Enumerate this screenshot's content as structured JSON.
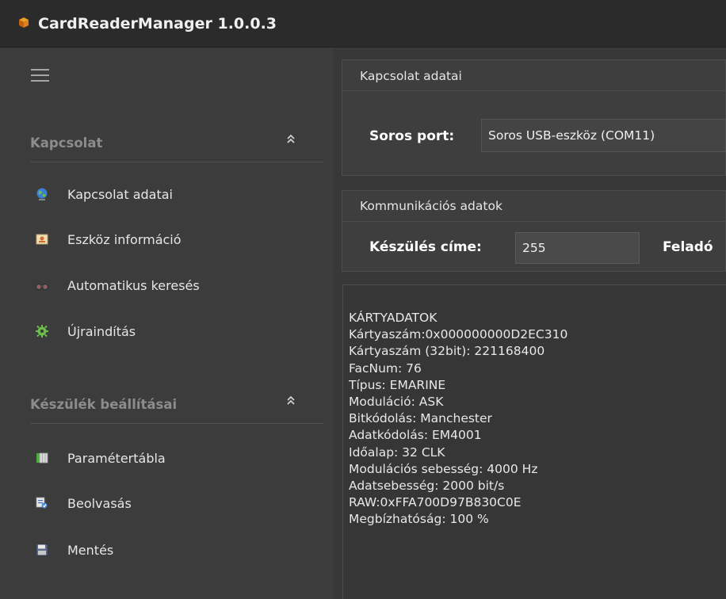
{
  "window": {
    "title": "CardReaderManager 1.0.0.3"
  },
  "sidebar": {
    "menu_icon": "hamburger-icon",
    "sections": [
      {
        "label": "Kapcsolat",
        "items": [
          {
            "label": "Kapcsolat adatai",
            "icon": "globe-icon"
          },
          {
            "label": "Eszköz információ",
            "icon": "device-info-icon"
          },
          {
            "label": "Automatikus keresés",
            "icon": "binoculars-icon"
          },
          {
            "label": "Újraindítás",
            "icon": "restart-gear-icon"
          }
        ]
      },
      {
        "label": "Készülék beállításai",
        "items": [
          {
            "label": "Paramétertábla",
            "icon": "table-icon"
          },
          {
            "label": "Beolvasás",
            "icon": "read-icon"
          },
          {
            "label": "Mentés",
            "icon": "save-icon"
          }
        ]
      }
    ]
  },
  "connection_panel": {
    "title": "Kapcsolat adatai",
    "serial_port_label": "Soros port:",
    "serial_port_value": "Soros USB-eszköz (COM11)"
  },
  "communication_panel": {
    "title": "Kommunikációs adatok",
    "device_address_label": "Készülés címe:",
    "device_address_value": "255",
    "sender_label": "Feladó"
  },
  "output": {
    "lines": [
      "KÁRTYADATOK",
      "Kártyaszám:0x000000000D2EC310",
      "Kártyaszám (32bit): 221168400",
      "FacNum: 76",
      "Típus: EMARINE",
      "Moduláció: ASK",
      "Bitkódolás: Manchester",
      "Adatkódolás: EM4001",
      "Időalap: 32 CLK",
      "Modulációs sebesség: 4000 Hz",
      "Adatsebesség: 2000 bit/s",
      "RAW:0xFFA700D97B830C0E",
      "Megbízhatóság: 100 %"
    ]
  },
  "colors": {
    "background": "#3a3a3a",
    "titlebar": "#2b2b2b",
    "section_header_text": "#8c8c8c",
    "text": "#e6e6e6"
  }
}
